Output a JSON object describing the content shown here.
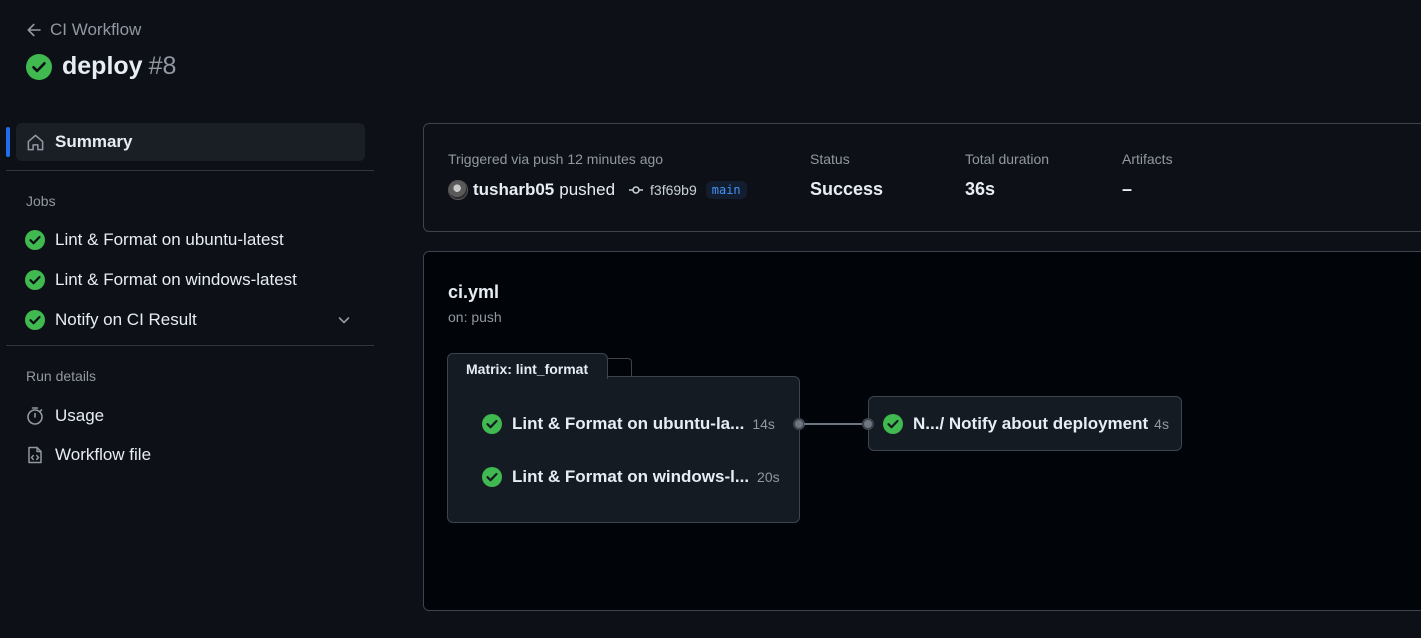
{
  "header": {
    "back_label": "CI Workflow",
    "workflow_name": "deploy",
    "run_number": "#8",
    "status": "success"
  },
  "sidebar": {
    "summary_label": "Summary",
    "jobs_heading": "Jobs",
    "jobs": [
      {
        "label": "Lint & Format on ubuntu-latest",
        "status": "success"
      },
      {
        "label": "Lint & Format on windows-latest",
        "status": "success"
      },
      {
        "label": "Notify on CI Result",
        "status": "success",
        "expandable": true
      }
    ],
    "run_details_heading": "Run details",
    "run_details": [
      {
        "label": "Usage",
        "icon": "stopwatch-icon"
      },
      {
        "label": "Workflow file",
        "icon": "file-code-icon"
      }
    ]
  },
  "summary": {
    "trigger_text": "Triggered via push 12 minutes ago",
    "user": "tusharb05",
    "action": "pushed",
    "commit_sha": "f3f69b9",
    "branch": "main",
    "status_label": "Status",
    "status_value": "Success",
    "duration_label": "Total duration",
    "duration_value": "36s",
    "artifacts_label": "Artifacts",
    "artifacts_value": "–"
  },
  "graph": {
    "file": "ci.yml",
    "trigger": "on: push",
    "matrix_label": "Matrix: lint_format",
    "matrix_jobs": [
      {
        "label": "Lint & Format on ubuntu-la...",
        "duration": "14s",
        "status": "success"
      },
      {
        "label": "Lint & Format on windows-l...",
        "duration": "20s",
        "status": "success"
      }
    ],
    "downstream_job": {
      "label": "N.../ Notify about deployment",
      "duration": "4s",
      "status": "success"
    }
  },
  "colors": {
    "success": "#3fb950",
    "accent": "#1f6feb",
    "branch_text": "#4493f8",
    "background": "#0d1117"
  }
}
